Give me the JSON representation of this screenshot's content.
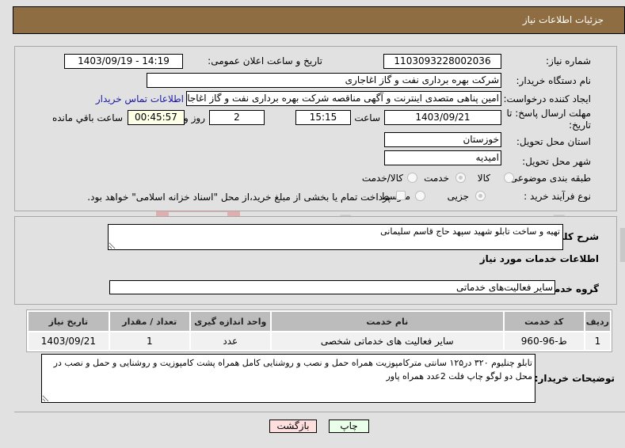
{
  "header": {
    "title": "جزئیات اطلاعات نیاز"
  },
  "form": {
    "need_number": {
      "label": "شماره نیاز:",
      "value": "1103093228002036"
    },
    "announce_datetime": {
      "label": "تاریخ و ساعت اعلان عمومی:",
      "value": "1403/09/19 - 14:19"
    },
    "buyer_org": {
      "label": "نام دستگاه خریدار:",
      "value": "شرکت بهره برداری نفت و گاز اغاجاری"
    },
    "requester": {
      "label": "ایجاد کننده درخواست:",
      "value": "امین پناهی متصدی اینترنت و آگهی مناقصه شرکت بهره برداری نفت و گاز اغاجار",
      "contact_link": "اطلاعات تماس خریدار"
    },
    "deadline": {
      "label": "مهلت ارسال پاسخ: تا تاریخ:",
      "date": "1403/09/21",
      "time_label": "ساعت",
      "time": "15:15",
      "days": "2",
      "days_label": "روز و",
      "remaining": "00:45:57",
      "remaining_label": "ساعت باقي مانده"
    },
    "province": {
      "label": "استان محل تحویل:",
      "value": "خوزستان"
    },
    "city": {
      "label": "شهر محل تحویل:",
      "value": "امیدیه"
    },
    "category": {
      "label": "طبقه بندی موضوعی:",
      "options": [
        "کالا",
        "خدمت",
        "کالا/خدمت"
      ],
      "selected": "خدمت"
    },
    "purchase_type": {
      "label": "نوع فرآیند خرید :",
      "options": [
        "جزیی",
        "متوسط"
      ],
      "selected": "جزیی",
      "treasury_checkbox_label": "پرداخت تمام یا بخشی از مبلغ خرید،از محل \"اسناد خزانه اسلامی\" خواهد بود.",
      "treasury_checked": false
    }
  },
  "description": {
    "label": "شرح کلي نیاز:",
    "value": "تهیه و ساخت تابلو شهید سپهد حاج قاسم سلیمانی"
  },
  "services_section": {
    "title": "اطلاعات خدمات مورد نیاز"
  },
  "service_group": {
    "label": "گروه خدمت:",
    "value": "سایر فعالیت‌های خدماتی"
  },
  "table": {
    "headers": [
      "ردیف",
      "کد خدمت",
      "نام خدمت",
      "واحد اندازه گیری",
      "تعداد / مقدار",
      "تاریخ نیاز"
    ],
    "rows": [
      [
        "1",
        "ط-96-960",
        "سایر فعالیت های خدماتی شخصی",
        "عدد",
        "1",
        "1403/09/21"
      ]
    ]
  },
  "buyer_notes": {
    "label": "توضیحات خریدار:",
    "value": "تابلو چنلیوم ۳۲۰ در۱۲۵ سانتی مترکامپوزیت همراه حمل و نصب و روشنایی کامل همراه پشت کامپوزیت و روشنایی و حمل و نصب در محل دو لوگو چاپ فلت 2عدد همراه پاور"
  },
  "buttons": {
    "print": "چاپ",
    "back": "بازگشت"
  },
  "colors": {
    "header_bg": "#8d6d41",
    "print_bg": "#eaffea",
    "back_bg": "#ffdede",
    "link": "#1a1aa6"
  },
  "watermark": {
    "text": "AriaTender.neT"
  }
}
